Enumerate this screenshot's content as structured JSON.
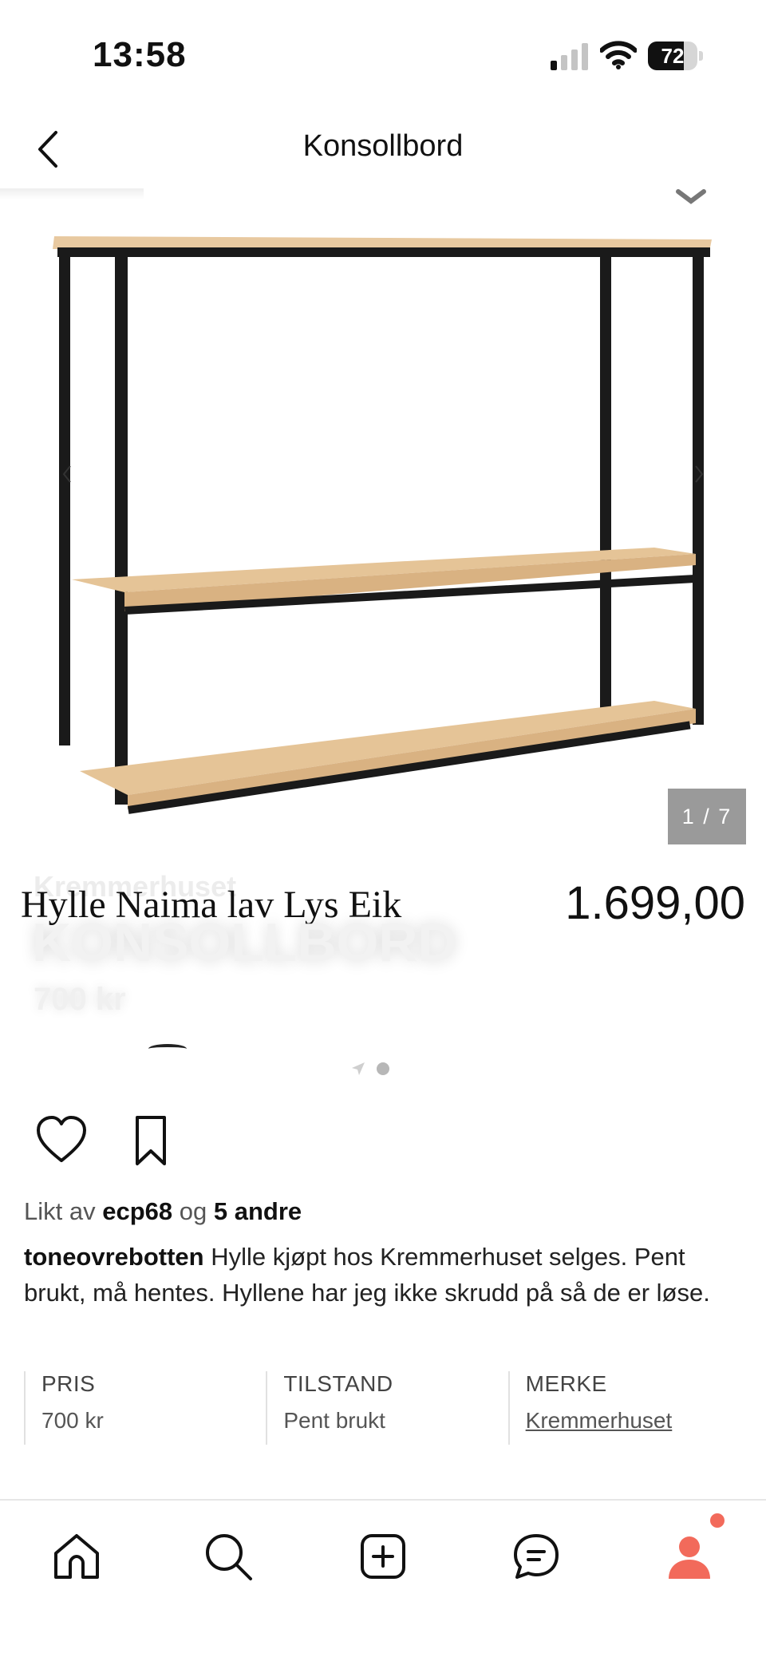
{
  "status_bar": {
    "time": "13:58",
    "battery_level": "72",
    "battery_fraction": 0.72
  },
  "header": {
    "title": "Konsollbord",
    "back_icon": "chevron-left-icon"
  },
  "image_carousel": {
    "counter": "1 / 7",
    "current_index": 1,
    "total": 7,
    "overlay_title": "Hylle Naima lav Lys Eik",
    "overlay_price": "1.699,00",
    "ghost_brand": "Kremmerhuset",
    "ghost_title": "KONSOLLBORD",
    "ghost_price": "700 kr"
  },
  "actions": {
    "like_icon": "heart-icon",
    "bookmark_icon": "bookmark-icon"
  },
  "likes": {
    "prefix": "Likt av",
    "user": "ecp68",
    "connector": "og",
    "others": "5 andre"
  },
  "post": {
    "author": "toneovrebotten",
    "text": "Hylle kjøpt hos Kremmerhuset selges. Pent brukt, må hentes. Hyllene har jeg ikke skrudd på så de er løse."
  },
  "details": [
    {
      "label": "PRIS",
      "value": "700 kr"
    },
    {
      "label": "TILSTAND",
      "value": "Pent brukt"
    },
    {
      "label": "MERKE",
      "value": "Kremmerhuset"
    }
  ],
  "tab_bar": {
    "tabs": [
      "home-icon",
      "search-icon",
      "add-icon",
      "messages-icon",
      "profile-icon"
    ],
    "accent_color": "#f26a5b"
  },
  "colors": {
    "wood": "#e3c39a",
    "frame": "#1a1a1a",
    "counter_bg": "#9a9a9a"
  }
}
